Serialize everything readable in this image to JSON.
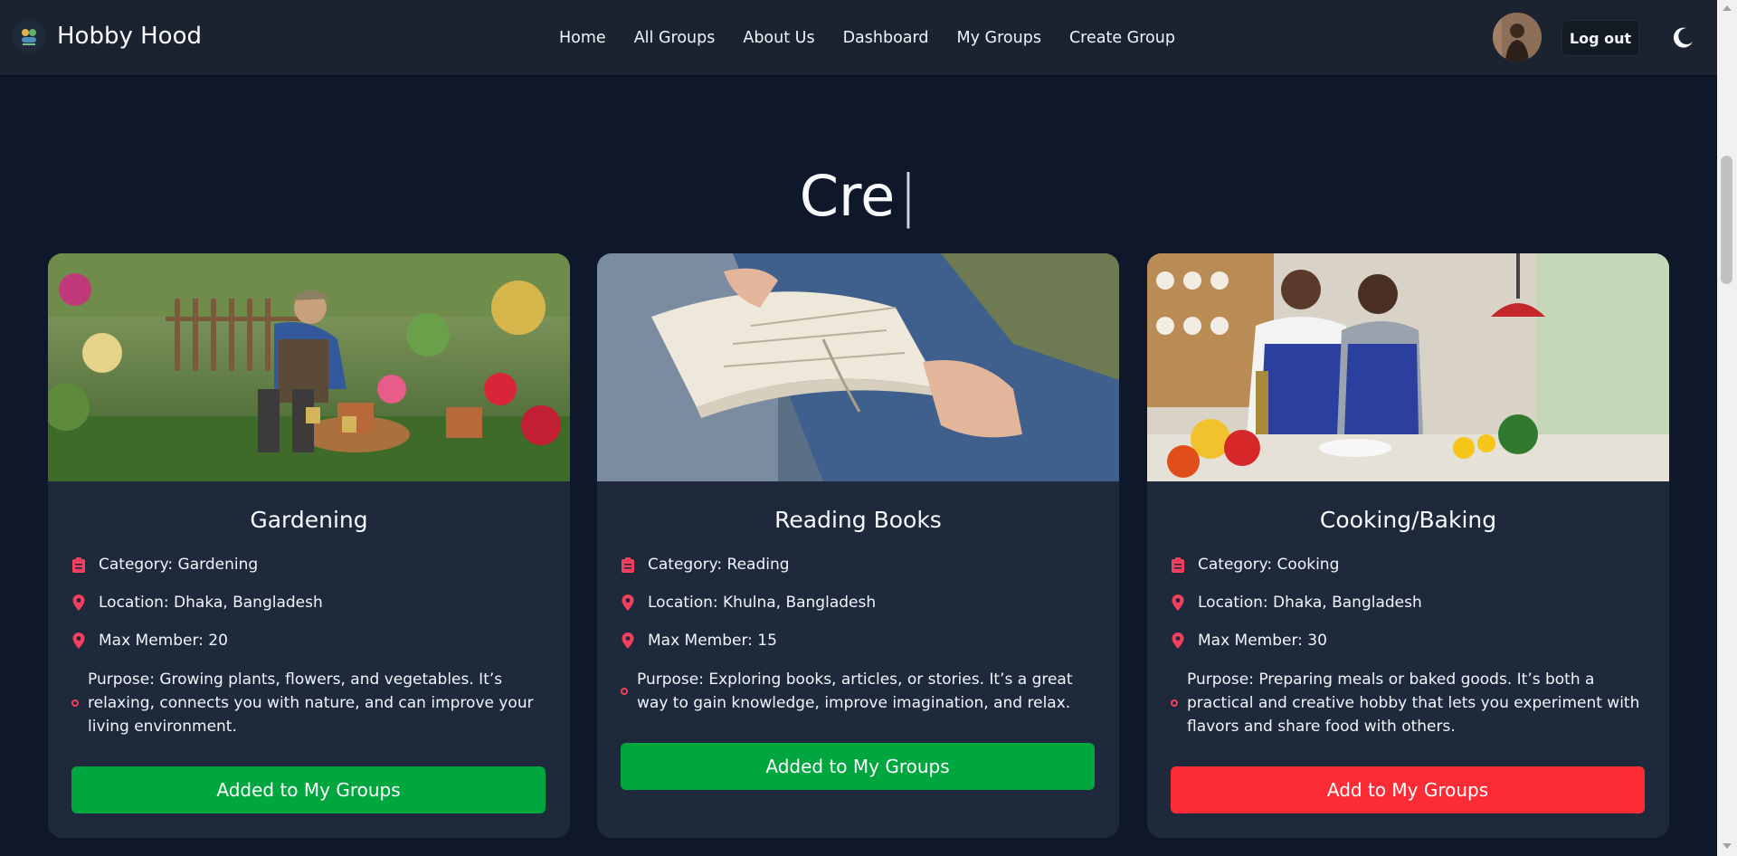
{
  "nav": {
    "brand": "Hobby Hood",
    "links": [
      "Home",
      "All Groups",
      "About Us",
      "Dashboard",
      "My Groups",
      "Create Group"
    ],
    "logout_label": "Log out",
    "theme_icon": "moon-icon"
  },
  "hero": {
    "typed_text": "Cre",
    "caret": "|"
  },
  "cards": [
    {
      "title": "Gardening",
      "category": "Category: Gardening",
      "location": "Location: Dhaka, Bangladesh",
      "max_member": "Max Member: 20",
      "purpose": "Purpose: Growing plants, flowers, and vegetables. It’s relaxing, connects you with nature, and can improve your living environment.",
      "button": "Added to My Groups",
      "button_state": "added"
    },
    {
      "title": "Reading Books",
      "category": "Category: Reading",
      "location": "Location: Khulna, Bangladesh",
      "max_member": "Max Member: 15",
      "purpose": "Purpose: Exploring books, articles, or stories. It’s a great way to gain knowledge, improve imagination, and relax.",
      "button": "Added to My Groups",
      "button_state": "added"
    },
    {
      "title": "Cooking/Baking",
      "category": "Category: Cooking",
      "location": "Location: Dhaka, Bangladesh",
      "max_member": "Max Member: 30",
      "purpose": "Purpose: Preparing meals or baked goods. It’s both a practical and creative hobby that lets you experiment with flavors and share food with others.",
      "button": "Add to My Groups",
      "button_state": "add"
    }
  ],
  "colors": {
    "background": "#0f172a",
    "navbar": "#1b2230",
    "card": "#1e293b",
    "icon_accent": "#f43f5e",
    "added_button": "#00a63e",
    "add_button": "#fb2c36"
  }
}
